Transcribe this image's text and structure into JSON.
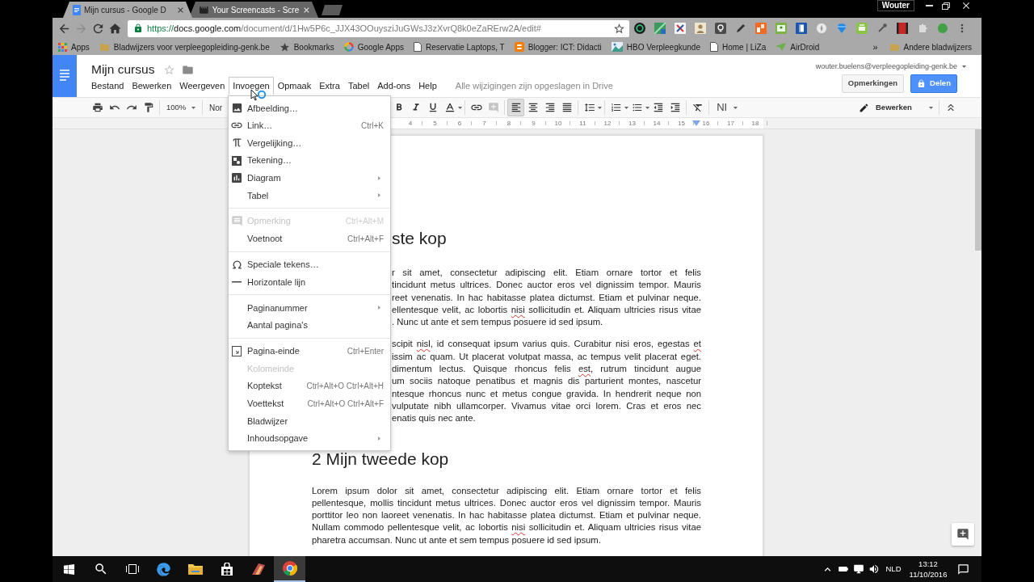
{
  "browser": {
    "tabs": [
      {
        "title": "Mijn cursus - Google D",
        "selected": true
      },
      {
        "title": "Your Screencasts - Scre",
        "selected": false
      }
    ],
    "profile": "Wouter",
    "url": {
      "scheme": "https://",
      "host": "docs.google.com",
      "path": "/document/d/1Hw5P6c_JJX43OOuysziJuGWsJ3zXvrQ8k0eZaRErw2A/edit#"
    },
    "bookmarks": [
      {
        "label": "Apps"
      },
      {
        "label": "Bladwijzers voor verpleegopleiding-genk.be"
      },
      {
        "label": "Bookmarks"
      },
      {
        "label": "Google Apps"
      },
      {
        "label": "Reservatie Laptops, T"
      },
      {
        "label": "Blogger: ICT: Didacti"
      },
      {
        "label": "HBO Verpleegkunde"
      },
      {
        "label": "Home | LiZa"
      },
      {
        "label": "AirDroid"
      }
    ],
    "overflow": "»",
    "other_bookmarks": "Andere bladwijzers"
  },
  "docs": {
    "title": "Mijn cursus",
    "account": "wouter.buelens@verpleegopleiding-genk.be",
    "comments_button": "Opmerkingen",
    "share_button": "Delen",
    "menus": [
      {
        "label": "Bestand",
        "selected": false
      },
      {
        "label": "Bewerken",
        "selected": false
      },
      {
        "label": "Weergeven",
        "selected": false
      },
      {
        "label": "Invoegen",
        "selected": true
      },
      {
        "label": "Opmaak",
        "selected": false
      },
      {
        "label": "Extra",
        "selected": false
      },
      {
        "label": "Tabel",
        "selected": false
      },
      {
        "label": "Add-ons",
        "selected": false
      },
      {
        "label": "Help",
        "selected": false
      }
    ],
    "save_status": "Alle wijzigingen zijn opgeslagen in Drive",
    "toolbar": {
      "zoom": "100%",
      "style": "Nor",
      "align_buttons": [
        {
          "selected": true
        },
        {
          "selected": false
        },
        {
          "selected": false
        },
        {
          "selected": false
        }
      ],
      "input_tools": "NI",
      "mode": "Bewerken"
    },
    "ruler": [
      "4",
      "5",
      "6",
      "7",
      "8",
      "9",
      "10",
      "11",
      "12",
      "13",
      "14",
      "15",
      "16",
      "17",
      "18"
    ]
  },
  "insert_menu": {
    "sections": [
      {
        "items": [
          {
            "label": "Afbeelding…",
            "submenu": false,
            "disabled": false
          },
          {
            "label": "Link…",
            "shortcut": "Ctrl+K",
            "submenu": false,
            "disabled": false
          },
          {
            "label": "Vergelijking…",
            "submenu": false,
            "disabled": false
          },
          {
            "label": "Tekening…",
            "submenu": false,
            "disabled": false
          },
          {
            "label": "Diagram",
            "submenu": true,
            "disabled": false
          },
          {
            "label": "Tabel",
            "submenu": true,
            "disabled": false
          }
        ]
      },
      {
        "items": [
          {
            "label": "Opmerking",
            "shortcut": "Ctrl+Alt+M",
            "submenu": false,
            "disabled": true
          },
          {
            "label": "Voetnoot",
            "shortcut": "Ctrl+Alt+F",
            "submenu": false,
            "disabled": false
          }
        ]
      },
      {
        "items": [
          {
            "label": "Speciale tekens…",
            "submenu": false,
            "disabled": false
          },
          {
            "label": "Horizontale lijn",
            "submenu": false,
            "disabled": false
          }
        ]
      },
      {
        "items": [
          {
            "label": "Paginanummer",
            "submenu": true,
            "disabled": false
          },
          {
            "label": "Aantal pagina's",
            "submenu": false,
            "disabled": false
          }
        ]
      },
      {
        "items": [
          {
            "label": "Pagina-einde",
            "shortcut": "Ctrl+Enter",
            "submenu": false,
            "disabled": false
          },
          {
            "label": "Kolomeinde",
            "submenu": false,
            "disabled": true
          },
          {
            "label": "Koptekst",
            "shortcut": "Ctrl+Alt+O Ctrl+Alt+H",
            "submenu": false,
            "disabled": false
          },
          {
            "label": "Voettekst",
            "shortcut": "Ctrl+Alt+O Ctrl+Alt+F",
            "submenu": false,
            "disabled": false
          },
          {
            "label": "Bladwijzer",
            "submenu": false,
            "disabled": false
          },
          {
            "label": "Inhoudsopgave",
            "submenu": true,
            "disabled": false
          }
        ]
      }
    ]
  },
  "document": {
    "blocks": [
      {
        "kind": "heading",
        "behind_menu": true,
        "text": "ste kop"
      },
      {
        "kind": "paragraph",
        "behind_menu": true,
        "lines": [
          {
            "segments": [
              {
                "text": "r sit amet, consectetur adipiscing elit. Etiam ornare tortor et felis",
                "misspelled": false
              }
            ]
          },
          {
            "segments": [
              {
                "text": "tincidunt metus ultrices. Donec auctor eros vel dignissim tempor. Mauris",
                "misspelled": false
              }
            ]
          },
          {
            "segments": [
              {
                "text": "reet venenatis. In hac habitasse platea dictumst. Etiam et pulvinar neque.",
                "misspelled": false
              }
            ]
          },
          {
            "segments": [
              {
                "text": "ellentesque velit, ac lobortis ",
                "misspelled": false
              },
              {
                "text": "nisi",
                "misspelled": true
              },
              {
                "text": " sollicitudin et. Aliquam ultricies risus vitae",
                "misspelled": false
              }
            ]
          },
          {
            "segments": [
              {
                "text": ". Nunc ut ante et sem tempus posuere id sed ipsum.",
                "misspelled": false
              }
            ]
          }
        ]
      },
      {
        "kind": "paragraph",
        "behind_menu": true,
        "lines": [
          {
            "segments": [
              {
                "text": "scipit ",
                "misspelled": false
              },
              {
                "text": "nisl",
                "misspelled": true
              },
              {
                "text": ", id consequat ipsum varius quis. Curabitur nisi eros, egestas ",
                "misspelled": false
              },
              {
                "text": "et",
                "misspelled": true
              }
            ]
          },
          {
            "segments": [
              {
                "text": "issim ac quam. Ut placerat volutpat massa, ac tempus velit placerat eget.",
                "misspelled": false
              }
            ]
          },
          {
            "segments": [
              {
                "text": "dimentum lectus. Quisque rhoncus felis ",
                "misspelled": false
              },
              {
                "text": "est",
                "misspelled": true
              },
              {
                "text": ", rutrum tincidunt augue",
                "misspelled": false
              }
            ]
          },
          {
            "segments": [
              {
                "text": "um sociis natoque penatibus et magnis dis parturient montes, nascetur",
                "misspelled": false
              }
            ]
          },
          {
            "segments": [
              {
                "text": "ntesque rhoncus nunc et metus congue gravida. In hendrerit neque non",
                "misspelled": false
              }
            ]
          },
          {
            "segments": [
              {
                "text": "vulputate nibh ullamcorper. Vivamus vitae orci lorem. Cras et eros nec",
                "misspelled": false
              }
            ]
          },
          {
            "segments": [
              {
                "text": "enatis quis nec ante.",
                "misspelled": false
              }
            ]
          }
        ]
      },
      {
        "kind": "heading",
        "behind_menu": false,
        "text": "2 Mijn tweede kop"
      },
      {
        "kind": "paragraph",
        "behind_menu": false,
        "lines": [
          {
            "segments": [
              {
                "text": "Lorem ipsum dolor sit amet, consectetur adipiscing elit. Etiam ornare tortor et felis",
                "misspelled": false
              }
            ]
          },
          {
            "segments": [
              {
                "text": "pellentesque, mollis tincidunt metus ultrices. Donec auctor eros vel dignissim tempor. Mauris",
                "misspelled": false
              }
            ]
          },
          {
            "segments": [
              {
                "text": "porttitor leo non laoreet venenatis. In hac habitasse platea dictumst. Etiam et pulvinar neque.",
                "misspelled": false
              }
            ]
          },
          {
            "segments": [
              {
                "text": "Nullam commodo pellentesque velit, ac lobortis ",
                "misspelled": false
              },
              {
                "text": "nisi",
                "misspelled": true
              },
              {
                "text": " sollicitudin et. Aliquam ultricies risus vitae",
                "misspelled": false
              }
            ]
          },
          {
            "segments": [
              {
                "text": "pharetra accumsan. Nunc ut ante et sem tempus posuere id sed ipsum.",
                "misspelled": false
              }
            ]
          }
        ]
      }
    ]
  },
  "taskbar": {
    "pinned": [
      {
        "active": false
      },
      {
        "active": false
      },
      {
        "active": false
      },
      {
        "active": false
      },
      {
        "active": true
      }
    ],
    "language": "NLD",
    "time": "13:12",
    "date": "11/10/2016"
  }
}
